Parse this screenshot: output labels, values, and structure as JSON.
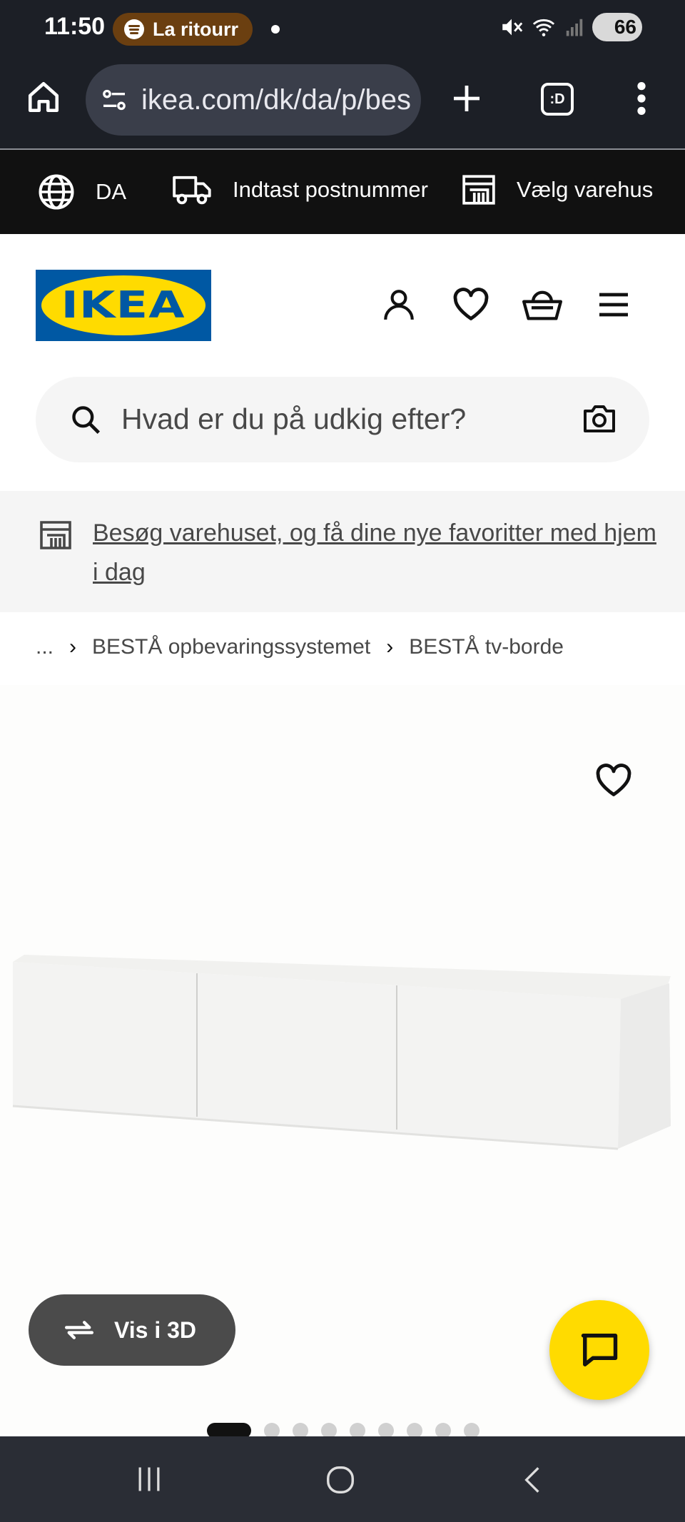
{
  "status_bar": {
    "time": "11:50",
    "media_pill": "La ritourr",
    "battery": "66"
  },
  "browser": {
    "url": "ikea.com/dk/da/p/bes",
    "tabs_label": ":D"
  },
  "utility_bar": {
    "language": "DA",
    "postcode": "Indtast postnummer",
    "store": "Vælg varehus"
  },
  "header": {
    "logo_text": "IKEA"
  },
  "search": {
    "placeholder": "Hvad er du på udkig efter?"
  },
  "banner": {
    "text": "Besøg varehuset, og få dine nye favoritter med hjem i dag"
  },
  "breadcrumb": {
    "ellipsis": "...",
    "items": [
      "BESTÅ opbevaringssystemet",
      "BESTÅ tv-borde"
    ]
  },
  "product": {
    "view_3d_label": "Vis i 3D",
    "carousel": {
      "total": 9,
      "active": 1
    }
  },
  "colors": {
    "ikea_blue": "#0058a3",
    "ikea_yellow": "#ffdb00",
    "status_bg": "#1c1f26",
    "util_bg": "#111111"
  }
}
